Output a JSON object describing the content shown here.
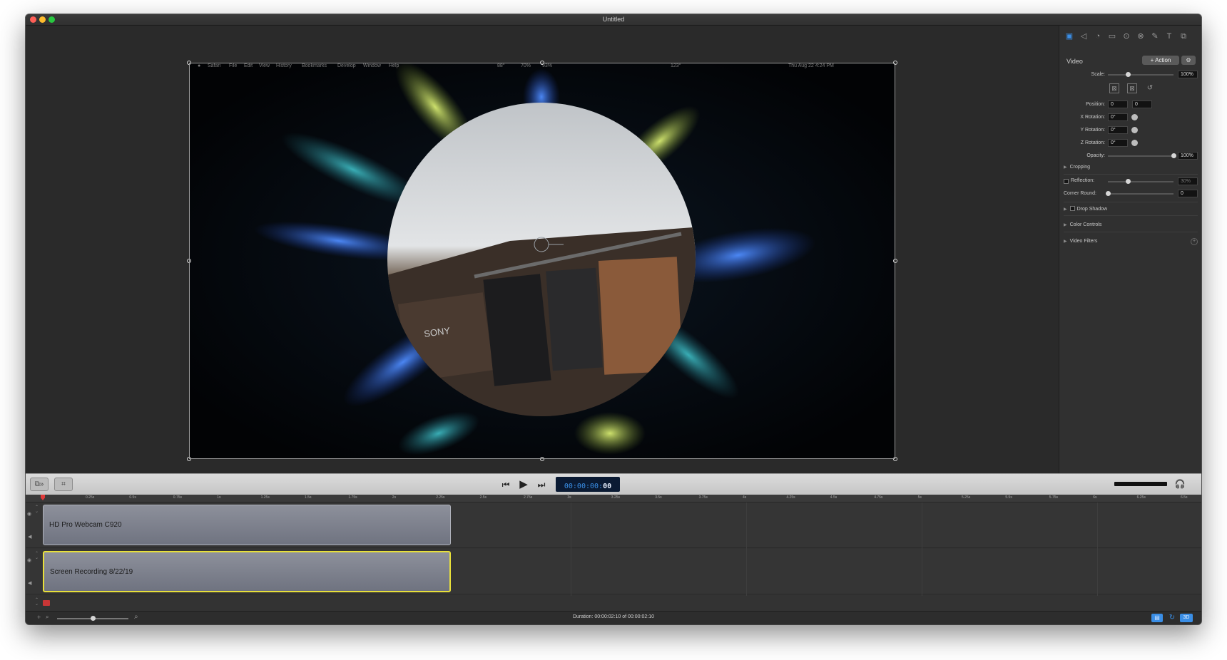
{
  "window": {
    "title": "Untitled",
    "traffic_colors": [
      "#ff5f57",
      "#febc2e",
      "#28c840"
    ]
  },
  "preview": {
    "menu_items": [
      "Safari",
      "File",
      "Edit",
      "View",
      "History",
      "Bookmarks",
      "Develop",
      "Window",
      "Help"
    ],
    "status_items": [
      "88°",
      "70%",
      "93%",
      "123°",
      "Thu Aug 22 4:24 PM"
    ],
    "brand_text": "SONY"
  },
  "inspector": {
    "tab_icons": [
      "video-icon",
      "audio-icon",
      "timing-icon",
      "screen-icon",
      "cursor-icon",
      "link-icon",
      "annotation-icon",
      "text-icon",
      "media-icon"
    ],
    "header": "Video",
    "action_label": "+ Action",
    "scale_label": "Scale:",
    "scale_value": "100%",
    "scale_level": 0.3,
    "position_label": "Position:",
    "position_x": "0",
    "position_y": "0",
    "x_rotation_label": "X Rotation:",
    "x_rotation": "0°",
    "y_rotation_label": "Y Rotation:",
    "y_rotation": "0°",
    "z_rotation_label": "Z Rotation:",
    "z_rotation": "0°",
    "opacity_label": "Opacity:",
    "opacity_value": "100%",
    "opacity_level": 1.0,
    "cropping_label": "Cropping",
    "reflection_label": "Reflection:",
    "reflection_value": "30%",
    "reflection_level": 0.3,
    "corner_round_label": "Corner Round:",
    "corner_round_value": "0",
    "corner_round_level": 0,
    "drop_shadow_label": "Drop Shadow",
    "color_controls_label": "Color Controls",
    "video_filters_label": "Video Filters"
  },
  "transport": {
    "timecode_main": "00:00:00",
    "timecode_frames": "00"
  },
  "timeline": {
    "ruler_ticks": [
      "0.25s",
      "0.5s",
      "0.75s",
      "1s",
      "1.25s",
      "1.5s",
      "1.75s",
      "2s",
      "2.25s",
      "2.5s",
      "2.75s",
      "3s",
      "3.25s",
      "3.5s",
      "3.75s",
      "4s",
      "4.25s",
      "4.5s",
      "4.75s",
      "5s",
      "5.25s",
      "5.5s",
      "5.75s",
      "6s",
      "6.25s",
      "6.5s"
    ],
    "clips": [
      {
        "name": "HD Pro Webcam C920",
        "selected": false
      },
      {
        "name": "Screen Recording 8/22/19",
        "selected": true
      }
    ],
    "zoom_level": 0.5
  },
  "status": {
    "duration": "Duration: 00:00:02:10 of 00:00:02:10",
    "right_badge": "3D"
  },
  "colors": {
    "accent": "#3a8ee6",
    "selection": "#e8e03a",
    "timecode_bg": "#0a1a33"
  }
}
